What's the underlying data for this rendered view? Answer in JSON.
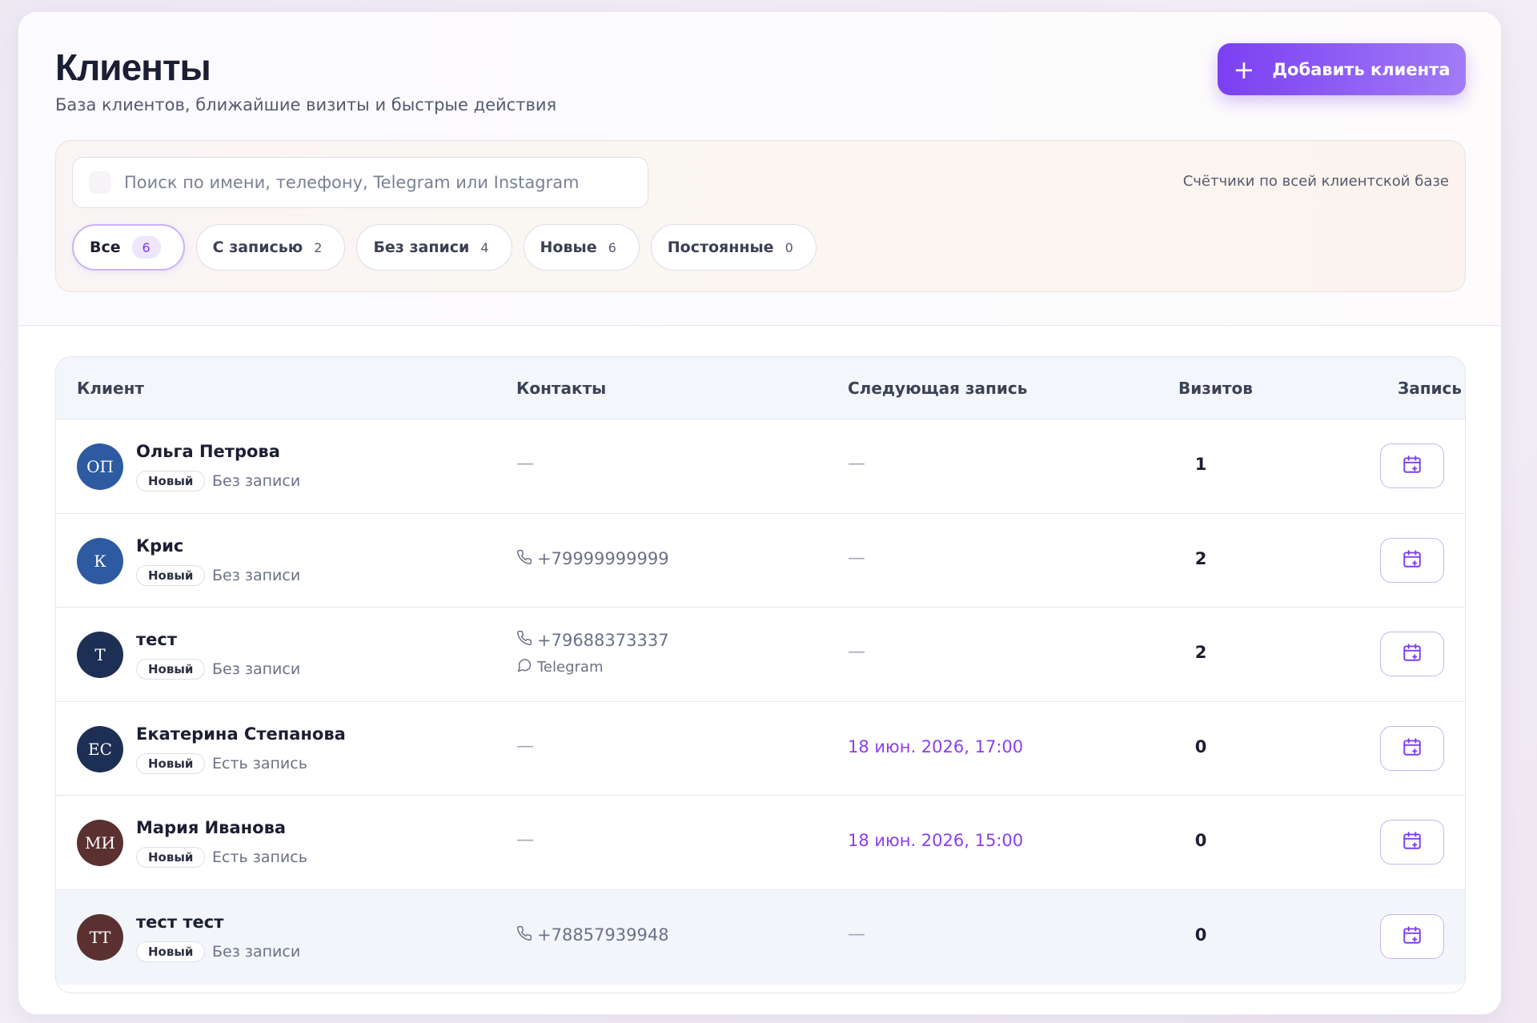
{
  "header": {
    "title": "Клиенты",
    "subtitle": "База клиентов, ближайшие визиты и быстрые действия",
    "add_button_label": "Добавить клиента"
  },
  "search": {
    "placeholder": "Поиск по имени, телефону, Telegram или Instagram",
    "value": ""
  },
  "counters_note": "Счётчики по всей клиентской базе",
  "filters": [
    {
      "label": "Все",
      "count": "6",
      "active": true
    },
    {
      "label": "С записью",
      "count": "2",
      "active": false
    },
    {
      "label": "Без записи",
      "count": "4",
      "active": false
    },
    {
      "label": "Новые",
      "count": "6",
      "active": false
    },
    {
      "label": "Постоянные",
      "count": "0",
      "active": false
    }
  ],
  "table": {
    "columns": [
      "Клиент",
      "Контакты",
      "Следующая запись",
      "Визитов",
      "Запись"
    ],
    "rows": [
      {
        "initials": "ОП",
        "avatar_color": "#2d5aa0",
        "name": "Ольга Петрова",
        "badge": "Новый",
        "status": "Без записи",
        "phone": "",
        "messenger": "",
        "next": "",
        "visits": "1"
      },
      {
        "initials": "К",
        "avatar_color": "#2d5aa0",
        "name": "Крис",
        "badge": "Новый",
        "status": "Без записи",
        "phone": "+79999999999",
        "messenger": "",
        "next": "",
        "visits": "2"
      },
      {
        "initials": "Т",
        "avatar_color": "#1e2f55",
        "name": "тест",
        "badge": "Новый",
        "status": "Без записи",
        "phone": "+79688373337",
        "messenger": "Telegram",
        "next": "",
        "visits": "2"
      },
      {
        "initials": "ЕС",
        "avatar_color": "#1e2f55",
        "name": "Екатерина Степанова",
        "badge": "Новый",
        "status": "Есть запись",
        "phone": "",
        "messenger": "",
        "next": "18 июн. 2026, 17:00",
        "visits": "0"
      },
      {
        "initials": "МИ",
        "avatar_color": "#5a3030",
        "name": "Мария Иванова",
        "badge": "Новый",
        "status": "Есть запись",
        "phone": "",
        "messenger": "",
        "next": "18 июн. 2026, 15:00",
        "visits": "0"
      },
      {
        "initials": "ТТ",
        "avatar_color": "#5a3030",
        "name": "тест тест",
        "badge": "Новый",
        "status": "Без записи",
        "phone": "+78857939948",
        "messenger": "",
        "next": "",
        "visits": "0"
      }
    ]
  },
  "empty_placeholder": "—",
  "colors": {
    "accent": "#7b3ff2",
    "next_date": "#8a3ff0"
  },
  "icons": {
    "add": "plus-icon",
    "phone": "phone-icon",
    "telegram": "chat-bubble-icon",
    "book": "calendar-plus-icon",
    "search": "search-icon"
  }
}
